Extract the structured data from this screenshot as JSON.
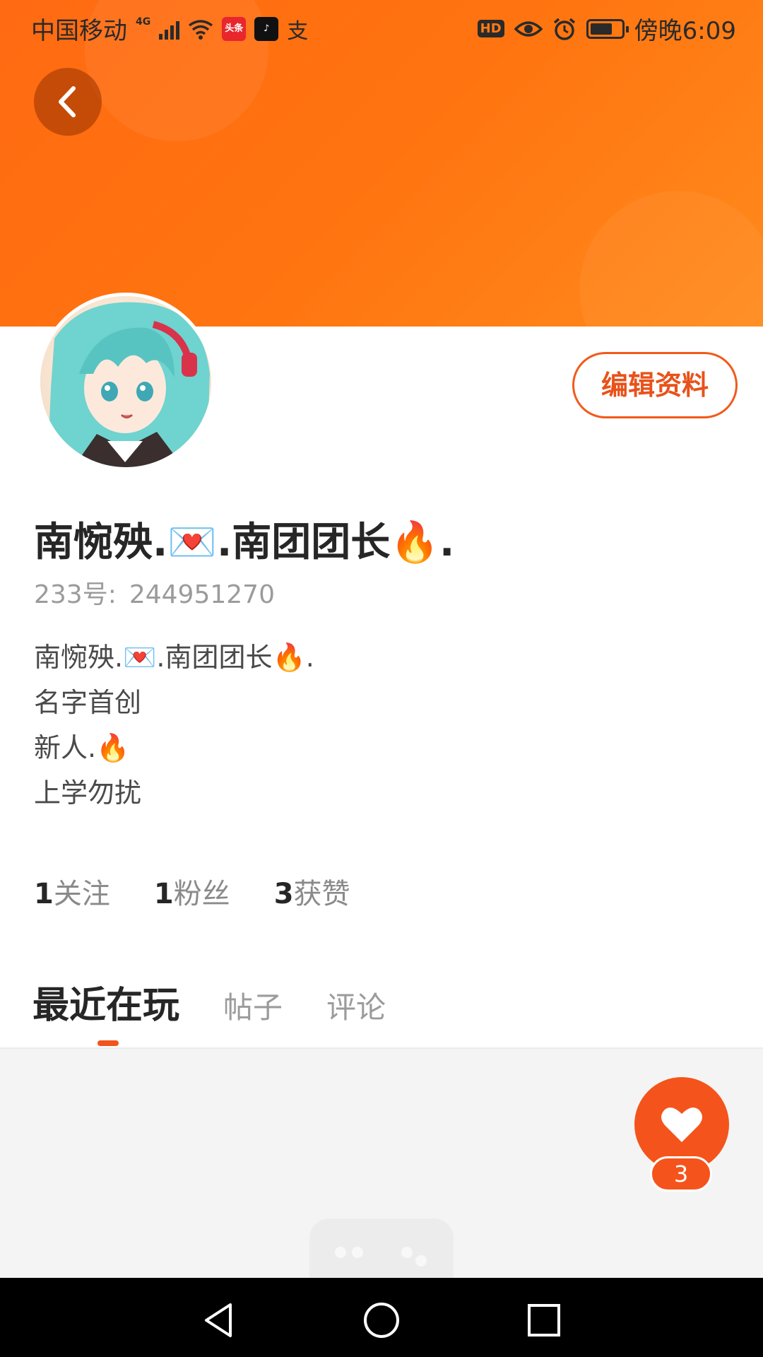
{
  "status_bar": {
    "carrier": "中国移动",
    "network": "4G",
    "apps": [
      "头条",
      "抖音",
      "支"
    ],
    "hd_badge": "HD",
    "time": "傍晚6:09"
  },
  "profile": {
    "nickname": "南惋殃.💌.南团团长🔥.",
    "id_label": "233号:",
    "id_value": "244951270",
    "edit_button": "编辑资料",
    "bio": [
      "南惋殃.💌.南团团长🔥.",
      "名字首创",
      "新人.🔥",
      "上学勿扰"
    ]
  },
  "stats": {
    "following_count": "1",
    "following_label": "关注",
    "fans_count": "1",
    "fans_label": "粉丝",
    "likes_count": "3",
    "likes_label": "获赞"
  },
  "tabs": [
    "最近在玩",
    "帖子",
    "评论"
  ],
  "active_tab": "最近在玩",
  "like_button": {
    "count": "3"
  },
  "colors": {
    "accent": "#f4541c",
    "banner": "#ff7410",
    "edit_button_border": "#f15a1a"
  },
  "icons": [
    "back-arrow-icon",
    "heart-icon",
    "nav-back-icon",
    "nav-home-icon",
    "nav-recents-icon"
  ]
}
